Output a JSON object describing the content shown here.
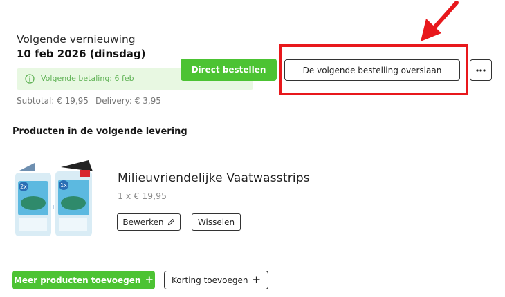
{
  "renewal": {
    "label": "Volgende vernieuwing",
    "date": "10 feb 2026 (dinsdag)"
  },
  "payment_banner": {
    "icon": "info-icon",
    "text": "Volgende betaling: 6 feb"
  },
  "totals": {
    "subtotal": "Subtotal: € 19,95",
    "delivery": "Delivery: € 3,95"
  },
  "actions": {
    "order_now": "Direct bestellen",
    "skip_next": "De volgende bestelling overslaan",
    "more_icon": "more-horizontal-icon"
  },
  "annotation": {
    "highlight_color": "#e8181c",
    "arrow_color": "#e8181c"
  },
  "section": {
    "title": "Producten in de volgende levering"
  },
  "product": {
    "name": "Milieuvriendelijke Vaatwasstrips",
    "price": "1 x € 19,95",
    "pack_labels": [
      "2x",
      "1x"
    ],
    "edit_label": "Bewerken",
    "edit_icon": "pencil-icon",
    "swap_label": "Wisselen"
  },
  "footer": {
    "add_products": "Meer producten toevoegen",
    "add_discount": "Korting toevoegen",
    "plus_icon": "+"
  },
  "colors": {
    "brand_green": "#4cc333",
    "banner_bg": "#e8f8e2",
    "banner_text": "#5fb255"
  }
}
